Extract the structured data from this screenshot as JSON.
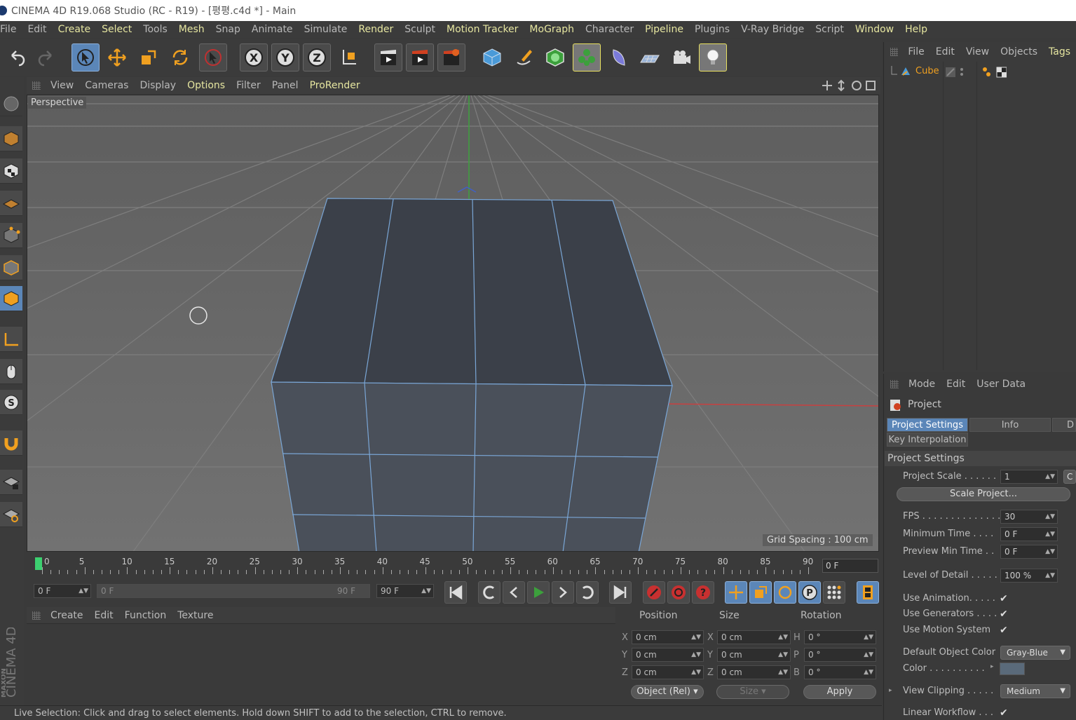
{
  "window": {
    "title": "CINEMA 4D R19.068 Studio (RC - R19) - [평평.c4d *] - Main"
  },
  "menu": [
    {
      "label": "File",
      "hl": false
    },
    {
      "label": "Edit",
      "hl": false
    },
    {
      "label": "Create",
      "hl": true
    },
    {
      "label": "Select",
      "hl": true
    },
    {
      "label": "Tools",
      "hl": false
    },
    {
      "label": "Mesh",
      "hl": true
    },
    {
      "label": "Snap",
      "hl": false
    },
    {
      "label": "Animate",
      "hl": false
    },
    {
      "label": "Simulate",
      "hl": false
    },
    {
      "label": "Render",
      "hl": true
    },
    {
      "label": "Sculpt",
      "hl": false
    },
    {
      "label": "Motion Tracker",
      "hl": true
    },
    {
      "label": "MoGraph",
      "hl": true
    },
    {
      "label": "Character",
      "hl": false
    },
    {
      "label": "Pipeline",
      "hl": true
    },
    {
      "label": "Plugins",
      "hl": false
    },
    {
      "label": "V-Ray Bridge",
      "hl": false
    },
    {
      "label": "Script",
      "hl": false
    },
    {
      "label": "Window",
      "hl": true
    },
    {
      "label": "Help",
      "hl": true
    }
  ],
  "viewport": {
    "menu": [
      {
        "label": "View",
        "hl": false
      },
      {
        "label": "Cameras",
        "hl": false
      },
      {
        "label": "Display",
        "hl": false
      },
      {
        "label": "Options",
        "hl": true
      },
      {
        "label": "Filter",
        "hl": false
      },
      {
        "label": "Panel",
        "hl": false
      },
      {
        "label": "ProRender",
        "hl": true
      }
    ],
    "camera_label": "Perspective",
    "grid_spacing": "Grid Spacing : 100 cm"
  },
  "timeline": {
    "ticks": [
      "0",
      "5",
      "10",
      "15",
      "20",
      "25",
      "30",
      "35",
      "40",
      "45",
      "50",
      "55",
      "60",
      "65",
      "70",
      "75",
      "80",
      "85",
      "90"
    ],
    "current_frame": "0 F",
    "start": "0 F",
    "range_start": "0 F",
    "range_end": "90 F",
    "end": "90 F"
  },
  "material_manager": {
    "menu": [
      "Create",
      "Edit",
      "Function",
      "Texture"
    ]
  },
  "coordinates": {
    "headers": {
      "position": "Position",
      "size": "Size",
      "rotation": "Rotation"
    },
    "pos": {
      "x": "0 cm",
      "y": "0 cm",
      "z": "0 cm"
    },
    "size": {
      "x": "0 cm",
      "y": "0 cm",
      "z": "0 cm"
    },
    "rot": {
      "h": "0 °",
      "p": "0 °",
      "b": "0 °"
    },
    "axes": {
      "x": "X",
      "y": "Y",
      "z": "Z",
      "h": "H",
      "p": "P",
      "b": "B"
    },
    "mode_dropdown": "Object (Rel)",
    "size_dropdown": "Size",
    "apply_label": "Apply"
  },
  "status": "Live Selection: Click and drag to select elements. Hold down SHIFT to add to the selection, CTRL to remove.",
  "object_manager": {
    "menu": [
      {
        "label": "File",
        "hl": false
      },
      {
        "label": "Edit",
        "hl": false
      },
      {
        "label": "View",
        "hl": false
      },
      {
        "label": "Objects",
        "hl": false
      },
      {
        "label": "Tags",
        "hl": true
      }
    ],
    "object_name": "Cube"
  },
  "attribute_manager": {
    "menu": [
      "Mode",
      "Edit",
      "User Data"
    ],
    "object": "Project",
    "tabs": {
      "project_settings": "Project Settings",
      "info": "Info",
      "next": "D",
      "key_interp": "Key Interpolation"
    },
    "section": "Project Settings",
    "project_scale_label": "Project Scale . . . . . .",
    "project_scale": "1",
    "project_scale_unit": "C",
    "scale_button": "Scale Project...",
    "fps_label": "FPS . . . . . . . . . . . . . . .",
    "fps": "30",
    "min_time_label": "Minimum Time . . . .",
    "min_time": "0 F",
    "prev_min_label": "Preview Min Time . .",
    "prev_min": "0 F",
    "lod_label": "Level of Detail . . . . .",
    "lod": "100 %",
    "use_anim_label": "Use Animation. . . . .",
    "use_gen_label": "Use Generators . . . .",
    "use_motion_label": "Use Motion System",
    "default_color_label": "Default Object Color",
    "default_color": "Gray-Blue",
    "color_label": "Color . . . . . . . . . .",
    "color_value": "#5a6a7a",
    "view_clip_label": "View Clipping . . . . .",
    "view_clip": "Medium",
    "linear_wf_label": "Linear Workflow . . .",
    "checkmark": "✔"
  },
  "colors": {
    "accent": "#5b86b8",
    "highlight_text": "#e6e6a0",
    "cube_face": "#3b4049",
    "cube_edge": "#7aa6d6",
    "axis_x": "#c84040",
    "axis_y": "#3ca03c",
    "axis_z": "#4060c8"
  }
}
